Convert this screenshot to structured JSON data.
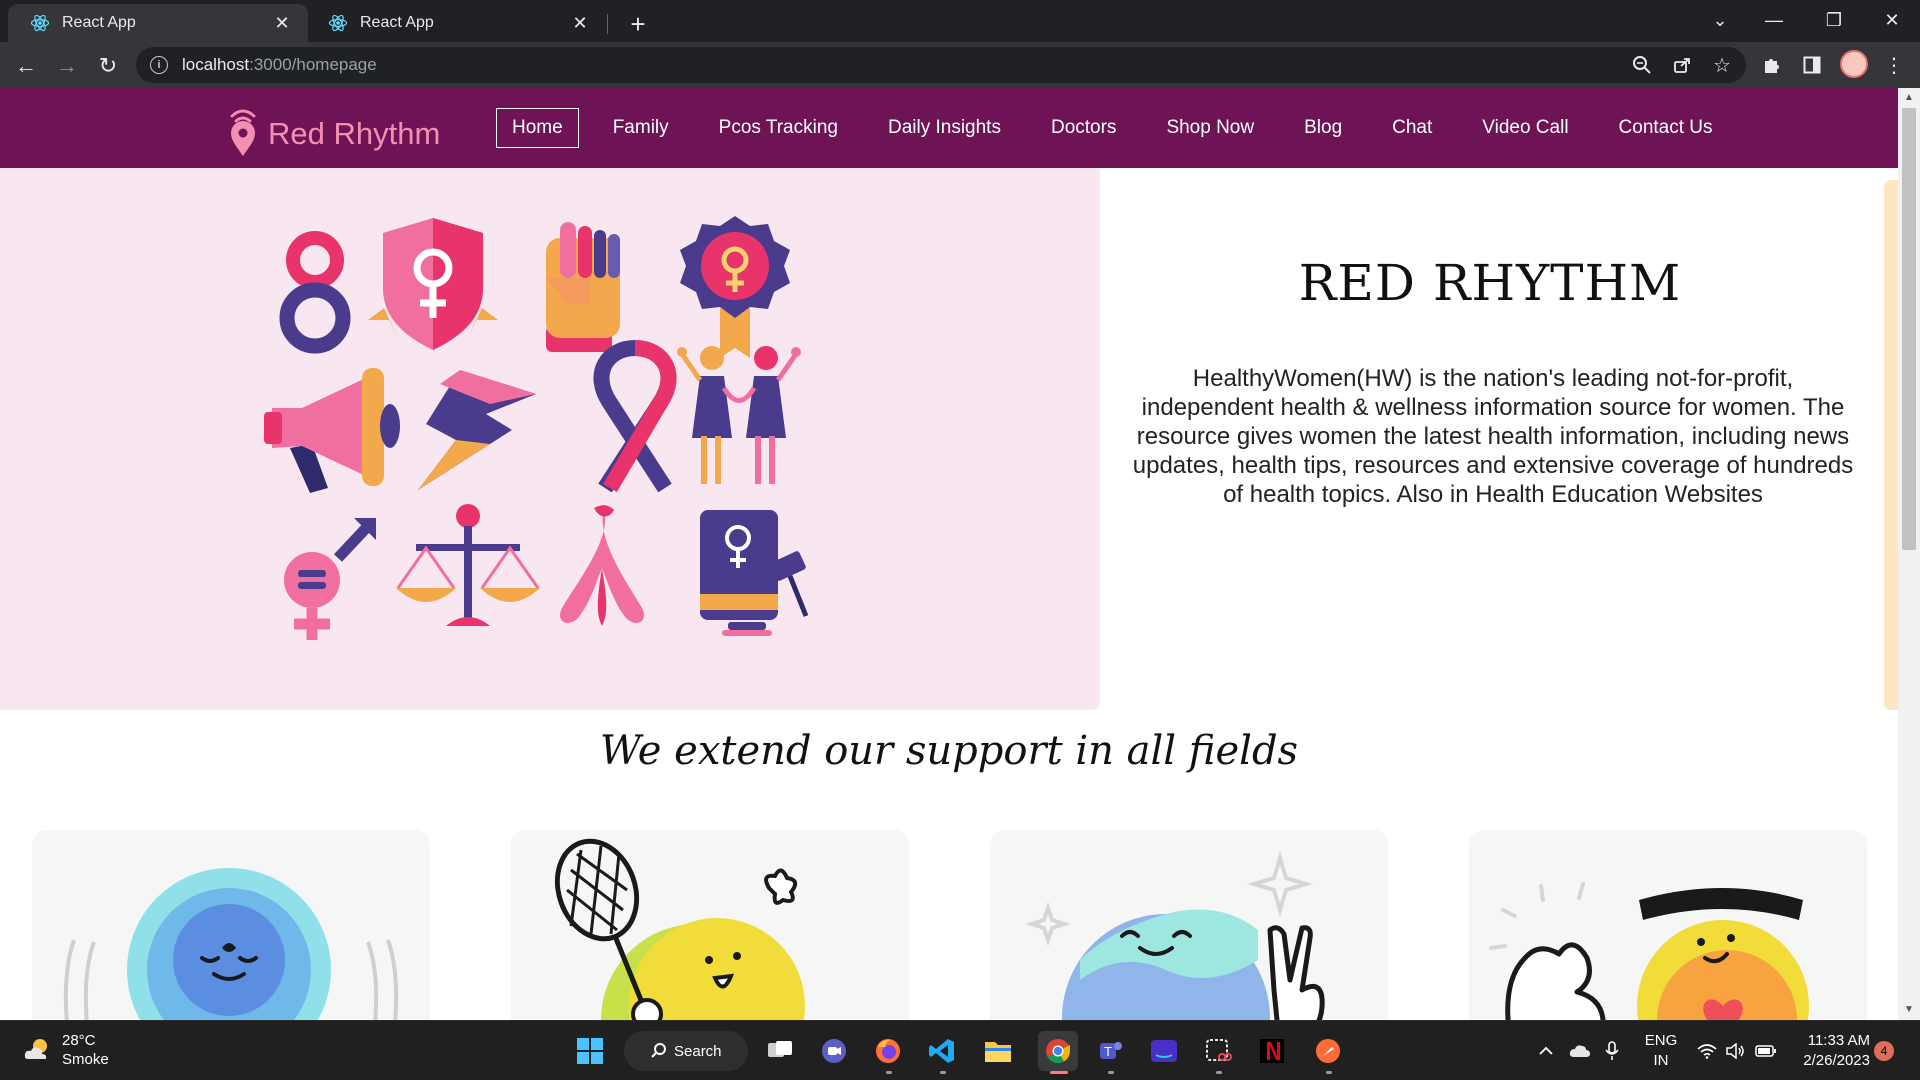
{
  "browser": {
    "tabs": [
      {
        "title": "React App",
        "active": true
      },
      {
        "title": "React App",
        "active": false
      }
    ],
    "url_host": "localhost",
    "url_rest": ":3000/homepage"
  },
  "site": {
    "brand": "Red Rhythm",
    "nav": [
      {
        "label": "Home",
        "active": true
      },
      {
        "label": "Family"
      },
      {
        "label": "Pcos Tracking"
      },
      {
        "label": "Daily Insights"
      },
      {
        "label": "Doctors"
      },
      {
        "label": "Shop Now"
      },
      {
        "label": "Blog"
      },
      {
        "label": "Chat"
      },
      {
        "label": "Video Call"
      },
      {
        "label": "Contact Us"
      }
    ],
    "hero": {
      "title": "RED RHYTHM",
      "description": "HealthyWomen(HW) is the nation's leading not-for-profit, independent health & wellness information source for women. The resource gives women the latest health information, including news updates, health tips, resources and extensive coverage of hundreds of health topics. Also in Health Education Websites"
    },
    "section_title": "We extend our support in all fields"
  },
  "taskbar": {
    "weather_temp": "28°C",
    "weather_desc": "Smoke",
    "search_label": "Search",
    "lang_line1": "ENG",
    "lang_line2": "IN",
    "time": "11:33 AM",
    "date": "2/26/2023",
    "notification_count": "4"
  },
  "colors": {
    "navbar": "#6e1456",
    "brand_pink": "#f48fb1",
    "hero_bg": "#f8e6f1",
    "accent_pink": "#e8336b",
    "accent_purple": "#4a3b8c",
    "accent_orange": "#f3a94b"
  }
}
